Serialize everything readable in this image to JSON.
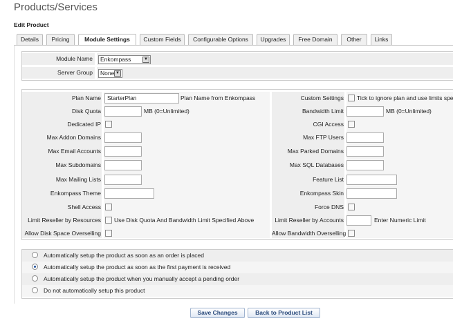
{
  "page": {
    "title": "Products/Services",
    "section": "Edit Product"
  },
  "tabs": [
    {
      "label": "Details"
    },
    {
      "label": "Pricing"
    },
    {
      "label": "Module Settings"
    },
    {
      "label": "Custom Fields"
    },
    {
      "label": "Configurable Options"
    },
    {
      "label": "Upgrades"
    },
    {
      "label": "Free Domain"
    },
    {
      "label": "Other"
    },
    {
      "label": "Links"
    }
  ],
  "module": {
    "module_name_label": "Module Name",
    "module_name_value": "Enkompass",
    "server_group_label": "Server Group",
    "server_group_value": "None"
  },
  "settings": {
    "plan_name_label": "Plan Name",
    "plan_name_value": "StarterPlan",
    "plan_name_hint": "Plan Name from Enkompass",
    "custom_settings_label": "Custom Settings",
    "custom_settings_hint": "Tick to ignore plan and use limits specif",
    "disk_quota_label": "Disk Quota",
    "disk_quota_unit": "MB (0=Unlimited)",
    "bandwidth_limit_label": "Bandwidth Limit",
    "bandwidth_limit_unit": "MB (0=Unlimited)",
    "dedicated_ip_label": "Dedicated IP",
    "cgi_access_label": "CGI Access",
    "max_addon_domains_label": "Max Addon Domains",
    "max_ftp_users_label": "Max FTP Users",
    "max_email_accounts_label": "Max Email Accounts",
    "max_parked_domains_label": "Max Parked Domains",
    "max_subdomains_label": "Max Subdomains",
    "max_sql_databases_label": "Max SQL Databases",
    "max_mailing_lists_label": "Max Mailing Lists",
    "feature_list_label": "Feature List",
    "theme_label": "Enkompass Theme",
    "skin_label": "Enkompass Skin",
    "shell_access_label": "Shell Access",
    "force_dns_label": "Force DNS",
    "limit_reseller_resources_label": "Limit Reseller by Resources",
    "limit_reseller_resources_hint": "Use Disk Quota And Bandwidth Limit Specified Above",
    "limit_reseller_accounts_label": "Limit Reseller by Accounts",
    "limit_reseller_accounts_hint": "Enter Numeric Limit",
    "allow_disk_overselling_label": "Allow Disk Space Overselling",
    "allow_bandwidth_overselling_label": "Allow Bandwidth Overselling"
  },
  "setup_options": [
    {
      "label": "Automatically setup the product as soon as an order is placed",
      "checked": false
    },
    {
      "label": "Automatically setup the product as soon as the first payment is received",
      "checked": true
    },
    {
      "label": "Automatically setup the product when you manually accept a pending order",
      "checked": false
    },
    {
      "label": "Do not automatically setup this product",
      "checked": false
    }
  ],
  "buttons": {
    "save": "Save Changes",
    "back": "Back to Product List"
  }
}
